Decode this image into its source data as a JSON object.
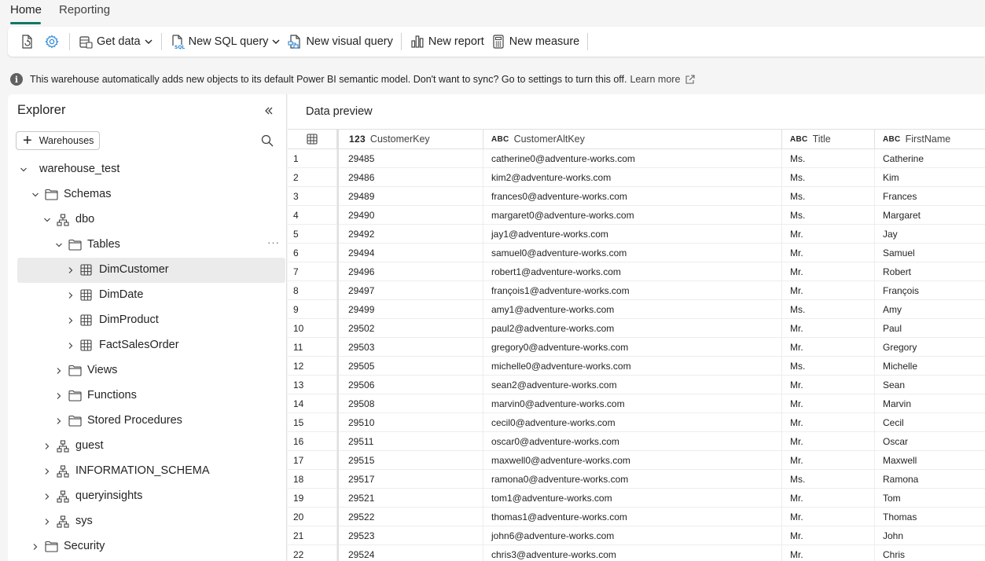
{
  "tabs": [
    {
      "label": "Home",
      "active": true
    },
    {
      "label": "Reporting",
      "active": false
    }
  ],
  "toolbar": {
    "icons": [
      "refresh-icon",
      "settings-gear-icon"
    ],
    "get_data": "Get data",
    "new_sql_query": "New SQL query",
    "new_visual_query": "New visual query",
    "new_report": "New report",
    "new_measure": "New measure"
  },
  "banner": {
    "message": "This warehouse automatically adds new objects to its default Power BI semantic model. Don't want to sync? Go to settings to turn this off.",
    "link": "Learn more"
  },
  "explorer": {
    "title": "Explorer",
    "add_button": "Warehouses",
    "tree": [
      {
        "label": "warehouse_test",
        "level": 0,
        "icon": "none",
        "expanded": true
      },
      {
        "label": "Schemas",
        "level": 1,
        "icon": "folder",
        "expanded": true
      },
      {
        "label": "dbo",
        "level": 2,
        "icon": "schema",
        "expanded": true
      },
      {
        "label": "Tables",
        "level": 3,
        "icon": "folder",
        "expanded": true,
        "more": true
      },
      {
        "label": "DimCustomer",
        "level": 4,
        "icon": "table",
        "expanded": false,
        "selected": true
      },
      {
        "label": "DimDate",
        "level": 4,
        "icon": "table",
        "expanded": false
      },
      {
        "label": "DimProduct",
        "level": 4,
        "icon": "table",
        "expanded": false
      },
      {
        "label": "FactSalesOrder",
        "level": 4,
        "icon": "table",
        "expanded": false
      },
      {
        "label": "Views",
        "level": 3,
        "icon": "folder",
        "expanded": false
      },
      {
        "label": "Functions",
        "level": 3,
        "icon": "folder",
        "expanded": false
      },
      {
        "label": "Stored Procedures",
        "level": 3,
        "icon": "folder",
        "expanded": false
      },
      {
        "label": "guest",
        "level": 2,
        "icon": "schema",
        "expanded": false
      },
      {
        "label": "INFORMATION_SCHEMA",
        "level": 2,
        "icon": "schema",
        "expanded": false
      },
      {
        "label": "queryinsights",
        "level": 2,
        "icon": "schema",
        "expanded": false
      },
      {
        "label": "sys",
        "level": 2,
        "icon": "schema",
        "expanded": false
      },
      {
        "label": "Security",
        "level": 1,
        "icon": "folder",
        "expanded": false
      }
    ]
  },
  "preview": {
    "title": "Data preview",
    "columns": [
      {
        "type": "123",
        "name": "CustomerKey"
      },
      {
        "type": "ABC",
        "name": "CustomerAltKey"
      },
      {
        "type": "ABC",
        "name": "Title"
      },
      {
        "type": "ABC",
        "name": "FirstName"
      }
    ],
    "rows": [
      [
        "1",
        "29485",
        "catherine0@adventure-works.com",
        "Ms.",
        "Catherine"
      ],
      [
        "2",
        "29486",
        "kim2@adventure-works.com",
        "Ms.",
        "Kim"
      ],
      [
        "3",
        "29489",
        "frances0@adventure-works.com",
        "Ms.",
        "Frances"
      ],
      [
        "4",
        "29490",
        "margaret0@adventure-works.com",
        "Ms.",
        "Margaret"
      ],
      [
        "5",
        "29492",
        "jay1@adventure-works.com",
        "Mr.",
        "Jay"
      ],
      [
        "6",
        "29494",
        "samuel0@adventure-works.com",
        "Mr.",
        "Samuel"
      ],
      [
        "7",
        "29496",
        "robert1@adventure-works.com",
        "Mr.",
        "Robert"
      ],
      [
        "8",
        "29497",
        "françois1@adventure-works.com",
        "Mr.",
        "François"
      ],
      [
        "9",
        "29499",
        "amy1@adventure-works.com",
        "Ms.",
        "Amy"
      ],
      [
        "10",
        "29502",
        "paul2@adventure-works.com",
        "Mr.",
        "Paul"
      ],
      [
        "11",
        "29503",
        "gregory0@adventure-works.com",
        "Mr.",
        "Gregory"
      ],
      [
        "12",
        "29505",
        "michelle0@adventure-works.com",
        "Ms.",
        "Michelle"
      ],
      [
        "13",
        "29506",
        "sean2@adventure-works.com",
        "Mr.",
        "Sean"
      ],
      [
        "14",
        "29508",
        "marvin0@adventure-works.com",
        "Mr.",
        "Marvin"
      ],
      [
        "15",
        "29510",
        "cecil0@adventure-works.com",
        "Mr.",
        "Cecil"
      ],
      [
        "16",
        "29511",
        "oscar0@adventure-works.com",
        "Mr.",
        "Oscar"
      ],
      [
        "17",
        "29515",
        "maxwell0@adventure-works.com",
        "Mr.",
        "Maxwell"
      ],
      [
        "18",
        "29517",
        "ramona0@adventure-works.com",
        "Ms.",
        "Ramona"
      ],
      [
        "19",
        "29521",
        "tom1@adventure-works.com",
        "Mr.",
        "Tom"
      ],
      [
        "20",
        "29522",
        "thomas1@adventure-works.com",
        "Mr.",
        "Thomas"
      ],
      [
        "21",
        "29523",
        "john6@adventure-works.com",
        "Mr.",
        "John"
      ],
      [
        "22",
        "29524",
        "chris3@adventure-works.com",
        "Mr.",
        "Chris"
      ]
    ]
  },
  "colors": {
    "accent": "#117865",
    "icon_blue": "#2b88d8"
  }
}
